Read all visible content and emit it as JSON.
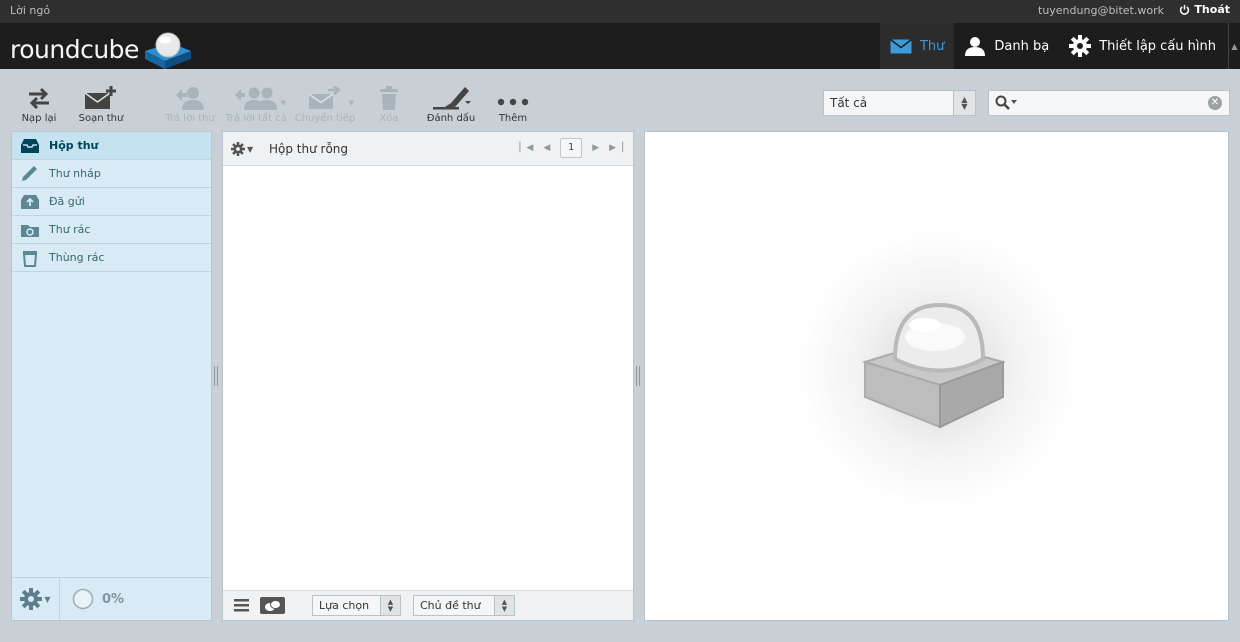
{
  "topline": {
    "greeting": "Lời ngỏ",
    "user_email": "tuyendung@bitet.work",
    "logout_label": "Thoát"
  },
  "header": {
    "logo_text": "roundcube",
    "tasks": {
      "mail": "Thư",
      "contacts": "Danh bạ",
      "settings": "Thiết lập cấu hình"
    }
  },
  "toolbar": {
    "reload": "Nạp lại",
    "compose": "Soạn thư",
    "reply": "Trả lời thư",
    "reply_all": "Trả lời tất cả",
    "forward": "Chuyển tiếp",
    "delete": "Xóa",
    "mark": "Đánh dấu",
    "more": "Thêm"
  },
  "filter": {
    "selected": "Tất cả"
  },
  "search": {
    "value": ""
  },
  "folders": {
    "items": [
      "Hộp thư",
      "Thư nháp",
      "Đã gửi",
      "Thư rác",
      "Thùng rác"
    ],
    "selected": "Hộp thư",
    "quota": "0%"
  },
  "messagelist": {
    "title": "Hộp thư rỗng",
    "page": "1",
    "select_label": "Lựa chọn",
    "threads_label": "Chủ đề thư"
  },
  "colors": {
    "accent": "#3d9ad6",
    "header": "#1d1d1d",
    "folder_bg": "#d8ebf4",
    "folder_selected": "#c4e2ef"
  }
}
